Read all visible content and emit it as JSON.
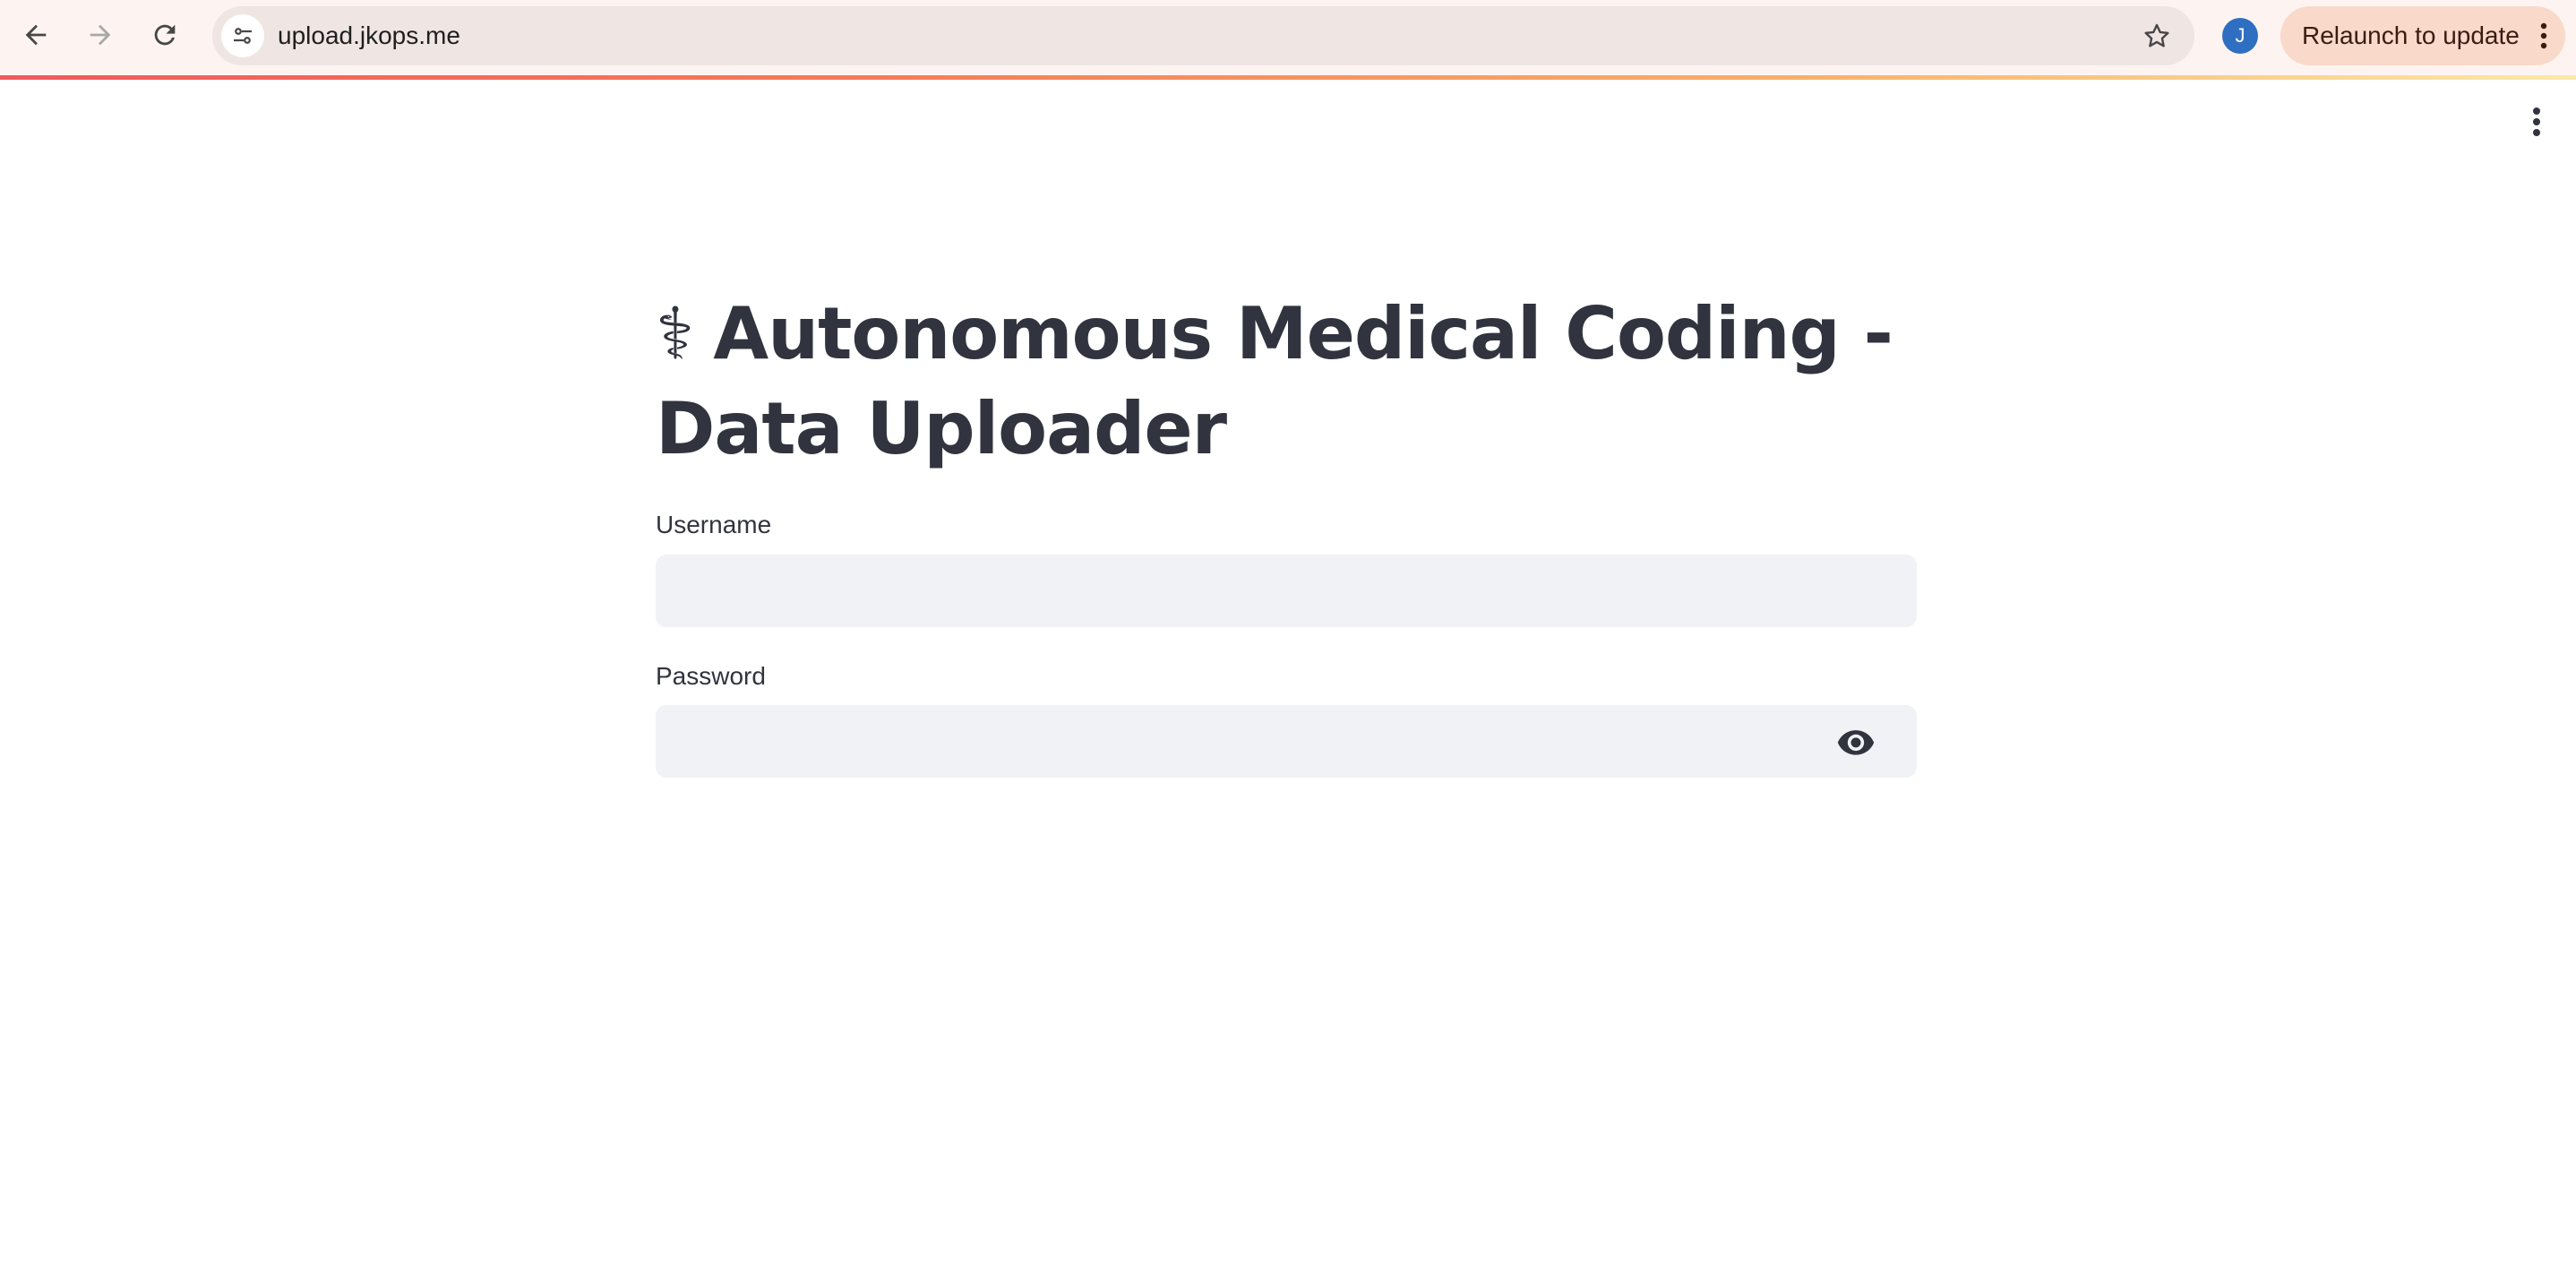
{
  "browser": {
    "url": "upload.jkops.me",
    "profile_initial": "J",
    "relaunch_label": "Relaunch to update"
  },
  "page": {
    "title_icon": "⚕",
    "title": "Autonomous Medical Coding - Data Uploader",
    "username_label": "Username",
    "username_value": "",
    "password_label": "Password",
    "password_value": ""
  },
  "icons": {
    "back": "back-arrow-icon",
    "forward": "forward-arrow-icon",
    "reload": "reload-icon",
    "site_info": "tune-icon",
    "bookmark": "star-icon",
    "menu": "more-vert-icon",
    "password_toggle": "eye-icon"
  },
  "colors": {
    "text_dark": "#31333f",
    "input_bg": "#f0f2f6",
    "relaunch_bg": "#f9d9c9",
    "avatar_bg": "#2f6fc2"
  }
}
